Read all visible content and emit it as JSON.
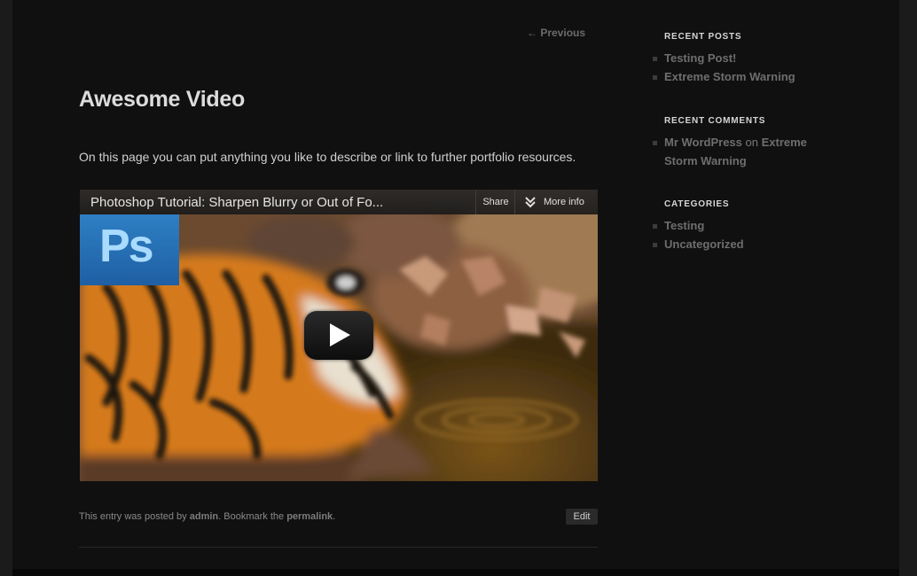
{
  "nav": {
    "previous_label": "← Previous"
  },
  "entry": {
    "title": "Awesome Video",
    "content": "On this page you can put anything you like to describe or link to further portfolio resources.",
    "meta_prefix": "This entry was posted by ",
    "meta_author": "admin",
    "meta_middle": ". Bookmark the ",
    "meta_permalink": "permalink",
    "meta_suffix": ".",
    "edit_label": "Edit"
  },
  "video": {
    "title": "Photoshop Tutorial: Sharpen Blurry or Out of Fo...",
    "share_label": "Share",
    "more_info_label": "More info",
    "logo_text": "Ps"
  },
  "sidebar": {
    "recent_posts": {
      "title": "RECENT POSTS",
      "items": [
        "Testing Post!",
        "Extreme Storm Warning"
      ]
    },
    "recent_comments": {
      "title": "RECENT COMMENTS",
      "author": "Mr WordPress",
      "connector": " on ",
      "post": "Extreme Storm Warning"
    },
    "categories": {
      "title": "CATEGORIES",
      "items": [
        "Testing",
        "Uncategorized"
      ]
    }
  },
  "colors": {
    "page_bg": "#101010",
    "outer_bg": "#1b1b1b",
    "title": "#dcdcdc",
    "link": "#6e6e6e"
  }
}
